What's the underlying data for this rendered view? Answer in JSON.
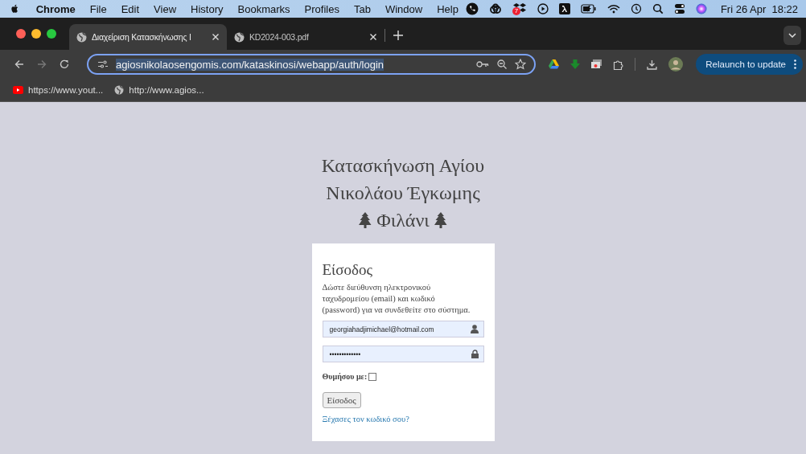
{
  "menu_bar": {
    "app": "Chrome",
    "items": [
      "File",
      "Edit",
      "View",
      "History",
      "Bookmarks",
      "Profiles",
      "Tab",
      "Window",
      "Help"
    ],
    "badge": "7",
    "clock": "Fri 26 Apr  18:22"
  },
  "tabs": [
    {
      "title": "Διαχείριση Κατασκήνωσης Ι",
      "selected": true
    },
    {
      "title": "KD2024-003.pdf",
      "selected": false
    }
  ],
  "address_bar": {
    "url": "agiosnikolaosengomis.com/kataskinosi/webapp/auth/login"
  },
  "relaunch_button": "Relaunch to update",
  "bookmarks": [
    {
      "label": "https://www.yout...",
      "kind": "video"
    },
    {
      "label": "http://www.agios...",
      "kind": "globe"
    }
  ],
  "page": {
    "site_title": "Κατασκήνωση Αγίου Νικολάου Έγκωμης",
    "site_subtitle": "Φιλάνι",
    "login": {
      "heading": "Είσοδος",
      "instructions": "Δώστε διεύθυνση ηλεκτρονικού ταχυδρομείου (email) και κωδικό (password) για να συνδεθείτε στο σύστημα.",
      "email": "georgiahadjimichael@hotmail.com",
      "password": "•••••••••••••",
      "remember_label": "Θυμήσου με:",
      "remember_checked": false,
      "submit": "Είσοδος",
      "forgot_link": "Ξέχασες τον κωδικό σου?"
    }
  }
}
